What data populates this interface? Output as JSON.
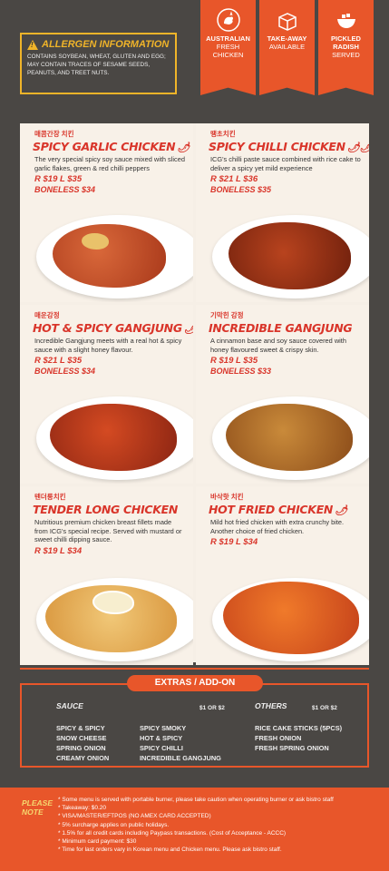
{
  "allergen": {
    "title": "ALLERGEN INFORMATION",
    "text": "CONTAINS SOYBEAN, WHEAT, GLUTEN AND EGG; MAY CONTAIN TRACES OF SESAME SEEDS, PEANUTS, AND TREET NUTS."
  },
  "badges": [
    {
      "l1": "AUSTRALIAN",
      "l2": "FRESH CHICKEN",
      "icon": "chicken-icon"
    },
    {
      "l1": "TAKE-AWAY",
      "l2": "AVAILABLE",
      "icon": "box-icon"
    },
    {
      "l1": "PICKLED RADISH",
      "l2": "SERVED",
      "icon": "bowl-icon"
    }
  ],
  "menu": [
    {
      "ko": "매콤간장 치킨",
      "name": "SPICY GARLIC CHICKEN",
      "chili": "🌶",
      "desc": "The very special spicy soy sauce mixed with sliced garlic flakes, green & red chilli peppers",
      "price": "R $19  L $35",
      "boneless": "BONELESS $34"
    },
    {
      "ko": "땡초치킨",
      "name": "SPICY CHILLI CHICKEN",
      "chili": "🌶🌶",
      "desc": "ICG's chilli paste sauce combined with rice cake to deliver a spicy yet mild experience",
      "price": "R $21  L $36",
      "boneless": "BONELESS $35"
    },
    {
      "ko": "매운강정",
      "name": "HOT & SPICY GANGJUNG",
      "chili": "🌶🌶🌶",
      "desc": "Incredible Gangjung meets with a real hot & spicy sauce with a slight honey flavour.",
      "price": "R $21  L $35",
      "boneless": "BONELESS $34"
    },
    {
      "ko": "기막힌 강정",
      "name": "INCREDIBLE GANGJUNG",
      "chili": "",
      "desc": "A cinnamon base and soy sauce covered with honey flavoured sweet & crispy skin.",
      "price": "R $19  L $35",
      "boneless": "BONELESS $33"
    },
    {
      "ko": "텐더롱치킨",
      "name": "TENDER LONG CHICKEN",
      "chili": "",
      "desc": "Nutritious premium chicken breast fillets made from ICG's special recipe. Served with mustard or sweet chilli dipping sauce.",
      "price": "R $19  L $34",
      "boneless": ""
    },
    {
      "ko": "바삭핫 치킨",
      "name": "HOT FRIED CHICKEN",
      "chili": "🌶",
      "desc": "Mild hot fried chicken with extra crunchy bite. Another choice of fried chicken.",
      "price": "R $19  L $34",
      "boneless": ""
    }
  ],
  "extras": {
    "title": "EXTRAS / ADD-ON",
    "sauce_head": "SAUCE",
    "sauce_price": "$1 OR $2",
    "sauce_col1": [
      "SPICY & SPICY",
      "SNOW CHEESE",
      "SPRING ONION",
      "CREAMY ONION"
    ],
    "sauce_col2": [
      "SPICY SMOKY",
      "HOT & SPICY",
      "SPICY CHILLI",
      "INCREDIBLE GANGJUNG"
    ],
    "others_head": "OTHERS",
    "others_price": "$1 OR $2",
    "others": [
      "RICE CAKE STICKS (5PCS)",
      "FRESH ONION",
      "FRESH SPRING ONION"
    ]
  },
  "note": {
    "title_l1": "PLEASE",
    "title_l2": "NOTE",
    "items": [
      "* Some menu is served with portable burner, please take caution when operating burner or ask bistro staff",
      "* Takeaway: $0.20",
      "* VISA/MASTER/EFTPOS (NO AMEX CARD ACCEPTED)",
      "* 5% surcharge applies on public holidays.",
      "* 1.5% for all credit cards including Paypass transactions. (Cost of Acceptance - ACCC)",
      "* Minimum card payment: $30",
      "* Time for last orders vary in Korean menu and Chicken menu. Please ask bistro staff."
    ]
  },
  "colors": {
    "accent": "#e8562a",
    "gold": "#f0b429",
    "red": "#d9352a",
    "bg": "#4a4744"
  }
}
